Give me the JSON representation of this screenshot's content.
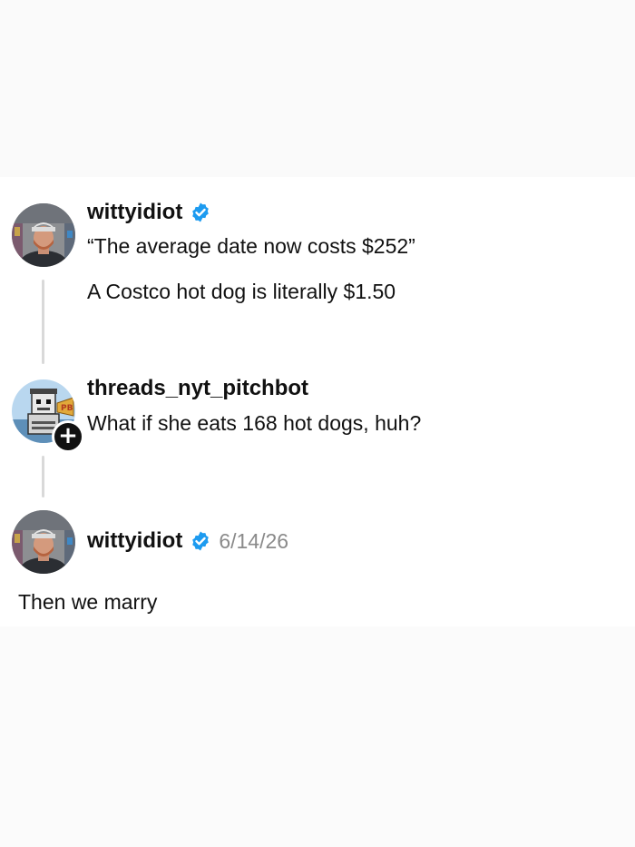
{
  "posts": [
    {
      "username": "wittyidiot",
      "verified": true,
      "lines": [
        "“The average date now costs $252”",
        "A Costco hot dog is literally $1.50"
      ],
      "avatar_icon": "user-avatar-man-cap"
    },
    {
      "username": "threads_nyt_pitchbot",
      "verified": false,
      "lines": [
        "What if she eats 168 hot dogs, huh?"
      ],
      "avatar_icon": "pitchbot-robot-avatar",
      "follow_icon": "plus-icon",
      "follow_symbol": "+"
    },
    {
      "username": "wittyidiot",
      "verified": true,
      "timestamp": "6/14/26",
      "lines": [
        "Then we marry"
      ],
      "avatar_icon": "user-avatar-man-cap"
    }
  ],
  "colors": {
    "verified_badge": "#1d9bf0",
    "thread_line": "#d9d9d9",
    "timestamp": "#8a8a8a"
  }
}
